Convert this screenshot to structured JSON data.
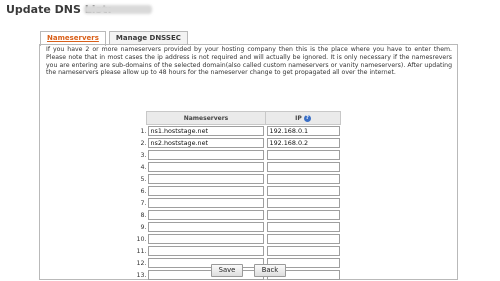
{
  "header": {
    "title": "Update DNS List:"
  },
  "tabs": [
    {
      "label": "Nameservers"
    },
    {
      "label": "Manage DNSSEC"
    }
  ],
  "info_text": "If you have 2 or more nameservers provided by your hosting company then this is the place where you have to enter them. Please note that in most cases the ip address is not required and will actually be ignored. It is only necessary if the namesrevers you are entering are sub-domains of the selected domain(also called custom nameservers or vanity nameservers). After updating the nameservers please allow up to 48 hours for the nameserver change to get propagated all over the internet.",
  "table": {
    "headers": {
      "nameservers": "Nameservers",
      "ip": "IP"
    },
    "rows": [
      {
        "num": "1.",
        "ns": "ns1.hoststage.net",
        "ip": "192.168.0.1"
      },
      {
        "num": "2.",
        "ns": "ns2.hoststage.net",
        "ip": "192.168.0.2"
      },
      {
        "num": "3.",
        "ns": "",
        "ip": ""
      },
      {
        "num": "4.",
        "ns": "",
        "ip": ""
      },
      {
        "num": "5.",
        "ns": "",
        "ip": ""
      },
      {
        "num": "6.",
        "ns": "",
        "ip": ""
      },
      {
        "num": "7.",
        "ns": "",
        "ip": ""
      },
      {
        "num": "8.",
        "ns": "",
        "ip": ""
      },
      {
        "num": "9.",
        "ns": "",
        "ip": ""
      },
      {
        "num": "10.",
        "ns": "",
        "ip": ""
      },
      {
        "num": "11.",
        "ns": "",
        "ip": ""
      },
      {
        "num": "12.",
        "ns": "",
        "ip": ""
      },
      {
        "num": "13.",
        "ns": "",
        "ip": ""
      }
    ]
  },
  "buttons": {
    "save": "Save",
    "back": "Back"
  },
  "icons": {
    "help": "question-icon"
  },
  "colors": {
    "active_tab": "#d9601a",
    "help_icon": "#3a6fc6"
  }
}
